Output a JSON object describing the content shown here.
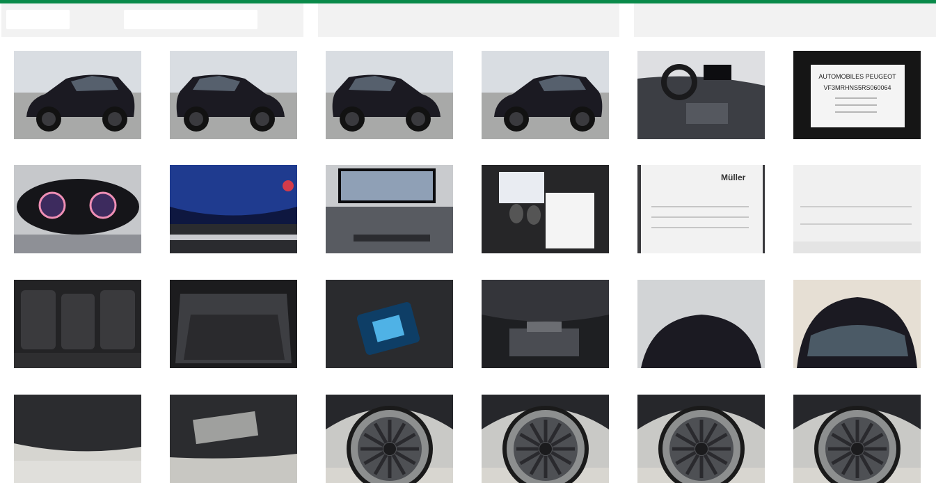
{
  "colors": {
    "accent": "#0a8a4a",
    "panel": "#f2f2f2",
    "car_paint": "#1b1a22"
  },
  "header": {
    "panels": [
      {
        "name": "filter-panel",
        "fields": [
          "",
          ""
        ]
      },
      {
        "name": "info-panel-center"
      },
      {
        "name": "info-panel-right"
      }
    ]
  },
  "gallery": {
    "rows": 4,
    "columns": 6,
    "photos": [
      {
        "subject": "exterior-front-left"
      },
      {
        "subject": "exterior-front-right"
      },
      {
        "subject": "exterior-rear-left"
      },
      {
        "subject": "exterior-rear-right"
      },
      {
        "subject": "interior-dashboard"
      },
      {
        "subject": "vin-plate",
        "label_lines": [
          "AUTOMOBILES PEUGEOT",
          "VF3MRHNS5RS060064"
        ]
      },
      {
        "subject": "instrument-cluster"
      },
      {
        "subject": "odometer-closeup"
      },
      {
        "subject": "infotainment-screen"
      },
      {
        "subject": "keys-and-manuals"
      },
      {
        "subject": "service-document",
        "label_lines": [
          "Müller"
        ]
      },
      {
        "subject": "document-page"
      },
      {
        "subject": "rear-seats"
      },
      {
        "subject": "trunk"
      },
      {
        "subject": "phone-charging-tray"
      },
      {
        "subject": "engine-bay"
      },
      {
        "subject": "roof-rear-view"
      },
      {
        "subject": "windshield-front-view"
      },
      {
        "subject": "underbody-front"
      },
      {
        "subject": "underbody-rear"
      },
      {
        "subject": "wheel-front-left"
      },
      {
        "subject": "wheel-front-right"
      },
      {
        "subject": "wheel-rear-left"
      },
      {
        "subject": "wheel-rear-right"
      }
    ]
  }
}
